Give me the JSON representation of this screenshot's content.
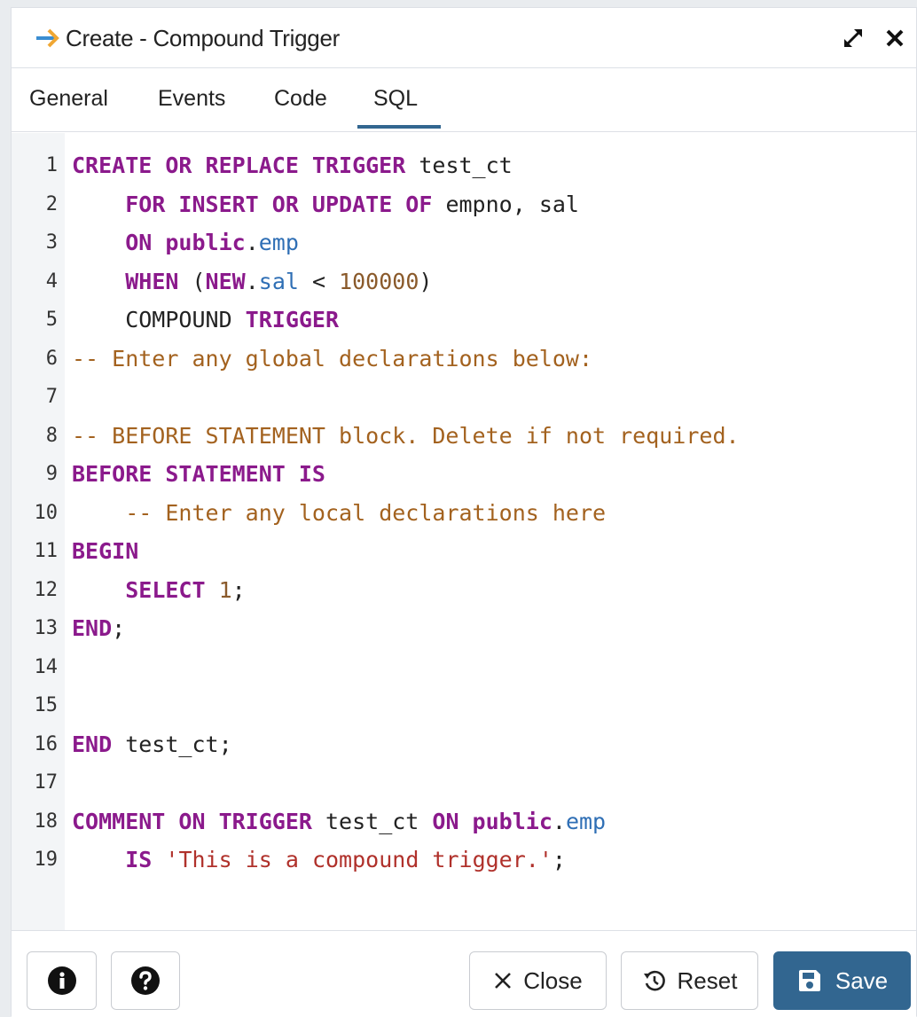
{
  "dialog": {
    "title": "Create - Compound Trigger",
    "title_icon": "trigger-arrow-icon",
    "accent_color": "#326690"
  },
  "tabs": [
    {
      "label": "General",
      "active": false
    },
    {
      "label": "Events",
      "active": false
    },
    {
      "label": "Code",
      "active": false
    },
    {
      "label": "SQL",
      "active": true
    }
  ],
  "editor": {
    "line_numbers": [
      "1",
      "2",
      "3",
      "4",
      "5",
      "6",
      "7",
      "8",
      "9",
      "10",
      "11",
      "12",
      "13",
      "14",
      "15",
      "16",
      "17",
      "18",
      "19"
    ],
    "lines": [
      [
        [
          "kw",
          "CREATE OR REPLACE TRIGGER"
        ],
        [
          "plain",
          " test_ct"
        ]
      ],
      [
        [
          "plain",
          "    "
        ],
        [
          "kw",
          "FOR INSERT OR UPDATE OF"
        ],
        [
          "plain",
          " empno, sal"
        ]
      ],
      [
        [
          "plain",
          "    "
        ],
        [
          "kw",
          "ON public"
        ],
        [
          "plain",
          "."
        ],
        [
          "var",
          "emp"
        ]
      ],
      [
        [
          "plain",
          "    "
        ],
        [
          "kw",
          "WHEN"
        ],
        [
          "plain",
          " ("
        ],
        [
          "kw",
          "NEW"
        ],
        [
          "plain",
          "."
        ],
        [
          "var",
          "sal"
        ],
        [
          "plain",
          " < "
        ],
        [
          "num",
          "100000"
        ],
        [
          "plain",
          ")"
        ]
      ],
      [
        [
          "plain",
          "    COMPOUND "
        ],
        [
          "kw",
          "TRIGGER"
        ]
      ],
      [
        [
          "cmt",
          "-- Enter any global declarations below:"
        ]
      ],
      [
        [
          "plain",
          ""
        ]
      ],
      [
        [
          "cmt",
          "-- BEFORE STATEMENT block. Delete if not required."
        ]
      ],
      [
        [
          "kw",
          "BEFORE STATEMENT IS"
        ]
      ],
      [
        [
          "plain",
          "    "
        ],
        [
          "cmt",
          "-- Enter any local declarations here"
        ]
      ],
      [
        [
          "kw",
          "BEGIN"
        ]
      ],
      [
        [
          "plain",
          "    "
        ],
        [
          "kw",
          "SELECT"
        ],
        [
          "plain",
          " "
        ],
        [
          "num",
          "1"
        ],
        [
          "plain",
          ";"
        ]
      ],
      [
        [
          "kw",
          "END"
        ],
        [
          "plain",
          ";"
        ]
      ],
      [
        [
          "plain",
          ""
        ]
      ],
      [
        [
          "plain",
          ""
        ]
      ],
      [
        [
          "kw",
          "END"
        ],
        [
          "plain",
          " test_ct;"
        ]
      ],
      [
        [
          "plain",
          ""
        ]
      ],
      [
        [
          "kw",
          "COMMENT ON TRIGGER"
        ],
        [
          "plain",
          " test_ct "
        ],
        [
          "kw",
          "ON public"
        ],
        [
          "plain",
          "."
        ],
        [
          "var",
          "emp"
        ]
      ],
      [
        [
          "plain",
          "    "
        ],
        [
          "kw",
          "IS"
        ],
        [
          "plain",
          " "
        ],
        [
          "str",
          "'This is a compound trigger.'"
        ],
        [
          "plain",
          ";"
        ]
      ]
    ],
    "colors": {
      "kw": "#8b1a8c",
      "plain": "#222222",
      "var": "#2f6fb5",
      "num": "#8a5a2b",
      "cmt": "#a3621f",
      "str": "#b0312b"
    }
  },
  "footer": {
    "info_icon": "info-icon",
    "help_icon": "help-icon",
    "close_label": "Close",
    "reset_label": "Reset",
    "save_label": "Save"
  }
}
